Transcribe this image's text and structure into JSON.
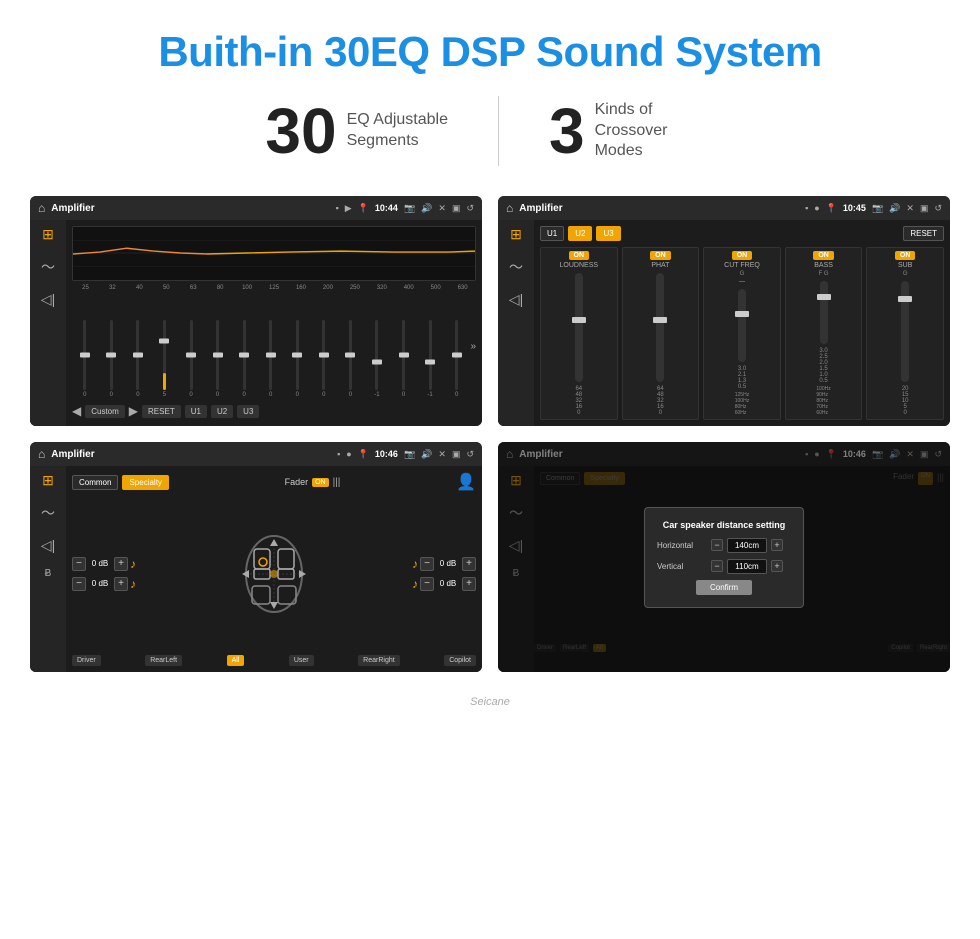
{
  "page": {
    "title": "Buith-in 30EQ DSP Sound System",
    "stats": [
      {
        "number": "30",
        "label": "EQ Adjustable\nSegments"
      },
      {
        "number": "3",
        "label": "Kinds of\nCrossover Modes"
      }
    ]
  },
  "screens": {
    "eq_screen": {
      "topbar": {
        "title": "Amplifier",
        "time": "10:44"
      },
      "freq_labels": [
        "25",
        "32",
        "40",
        "50",
        "63",
        "80",
        "100",
        "125",
        "160",
        "200",
        "250",
        "320",
        "400",
        "500",
        "630"
      ],
      "sliders": [
        0,
        0,
        0,
        5,
        0,
        0,
        0,
        0,
        0,
        0,
        0,
        -1,
        0,
        -1,
        0
      ],
      "bottom_buttons": [
        "Custom",
        "RESET",
        "U1",
        "U2",
        "U3"
      ]
    },
    "crossover_screen": {
      "topbar": {
        "title": "Amplifier",
        "time": "10:45"
      },
      "presets": [
        "U1",
        "U2",
        "U3"
      ],
      "active_preset": "U3",
      "channels": [
        {
          "label": "LOUDNESS",
          "status": "ON",
          "sub": ""
        },
        {
          "label": "PHAT",
          "status": "ON",
          "sub": ""
        },
        {
          "label": "CUT FREQ",
          "status": "ON",
          "sub": "G"
        },
        {
          "label": "BASS",
          "status": "ON",
          "sub": "F G"
        },
        {
          "label": "SUB",
          "status": "ON",
          "sub": "G"
        }
      ]
    },
    "specialty_screen": {
      "topbar": {
        "title": "Amplifier",
        "time": "10:46"
      },
      "tabs": [
        "Common",
        "Specialty"
      ],
      "active_tab": "Specialty",
      "fader_label": "Fader",
      "fader_on": "ON",
      "balance_values": {
        "top_left": "0 dB",
        "top_right": "0 dB",
        "bottom_left": "0 dB",
        "bottom_right": "0 dB"
      },
      "channel_buttons": [
        "Driver",
        "RearLeft",
        "All",
        "User",
        "RearRight",
        "Copilot"
      ]
    },
    "dialog_screen": {
      "topbar": {
        "title": "Amplifier",
        "time": "10:46"
      },
      "dialog": {
        "title": "Car speaker distance setting",
        "rows": [
          {
            "label": "Horizontal",
            "value": "140cm"
          },
          {
            "label": "Vertical",
            "value": "110cm"
          }
        ],
        "confirm_label": "Confirm"
      }
    }
  },
  "watermark": "Seicane"
}
